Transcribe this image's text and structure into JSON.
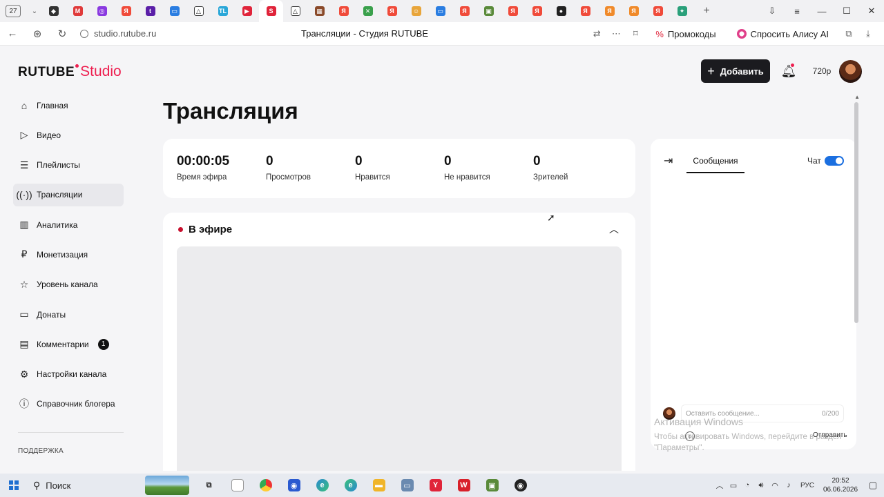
{
  "browser": {
    "tab_count": "27",
    "page_title": "Трансляции - Студия RUTUBE",
    "url": "studio.rutube.ru",
    "promo_label": "Промокоды",
    "alice_label": "Спросить Алису AI"
  },
  "header": {
    "logo_rutube": "RUTUBE",
    "logo_studio": "Studio",
    "add_label": "Добавить",
    "quality": "720p"
  },
  "sidebar": {
    "items": [
      {
        "label": "Главная",
        "icon": "home-icon"
      },
      {
        "label": "Видео",
        "icon": "video-icon"
      },
      {
        "label": "Плейлисты",
        "icon": "playlist-icon"
      },
      {
        "label": "Трансляции",
        "icon": "broadcast-icon"
      },
      {
        "label": "Аналитика",
        "icon": "analytics-icon"
      },
      {
        "label": "Монетизация",
        "icon": "ruble-icon"
      },
      {
        "label": "Уровень канала",
        "icon": "star-icon"
      },
      {
        "label": "Донаты",
        "icon": "wallet-icon"
      },
      {
        "label": "Комментарии",
        "icon": "comment-icon",
        "badge": "1"
      },
      {
        "label": "Настройки канала",
        "icon": "gear-icon"
      },
      {
        "label": "Справочник блогера",
        "icon": "info-icon"
      }
    ],
    "section": "ПОДДЕРЖКА"
  },
  "main": {
    "title": "Трансляция",
    "stats": [
      {
        "value": "00:00:05",
        "label": "Время эфира"
      },
      {
        "value": "0",
        "label": "Просмотров"
      },
      {
        "value": "0",
        "label": "Нравится"
      },
      {
        "value": "0",
        "label": "Не нравится"
      },
      {
        "value": "0",
        "label": "Зрителей"
      }
    ],
    "live_label": "В эфире"
  },
  "chat": {
    "tab": "Сообщения",
    "toggle_label": "Чат",
    "toggle_on": true,
    "placeholder": "Оставить сообщение...",
    "counter": "0/200",
    "send": "Отправить"
  },
  "watermark": {
    "title": "Активация Windows",
    "text": "Чтобы активировать Windows, перейдите в раздел \"Параметры\"."
  },
  "taskbar": {
    "search": "Поиск",
    "lang": "РУС",
    "time": "20:52",
    "date": "06.06.2026"
  },
  "colors": {
    "brand": "#ee1f50",
    "live": "#c8102e",
    "toggle": "#1b6fe0"
  }
}
